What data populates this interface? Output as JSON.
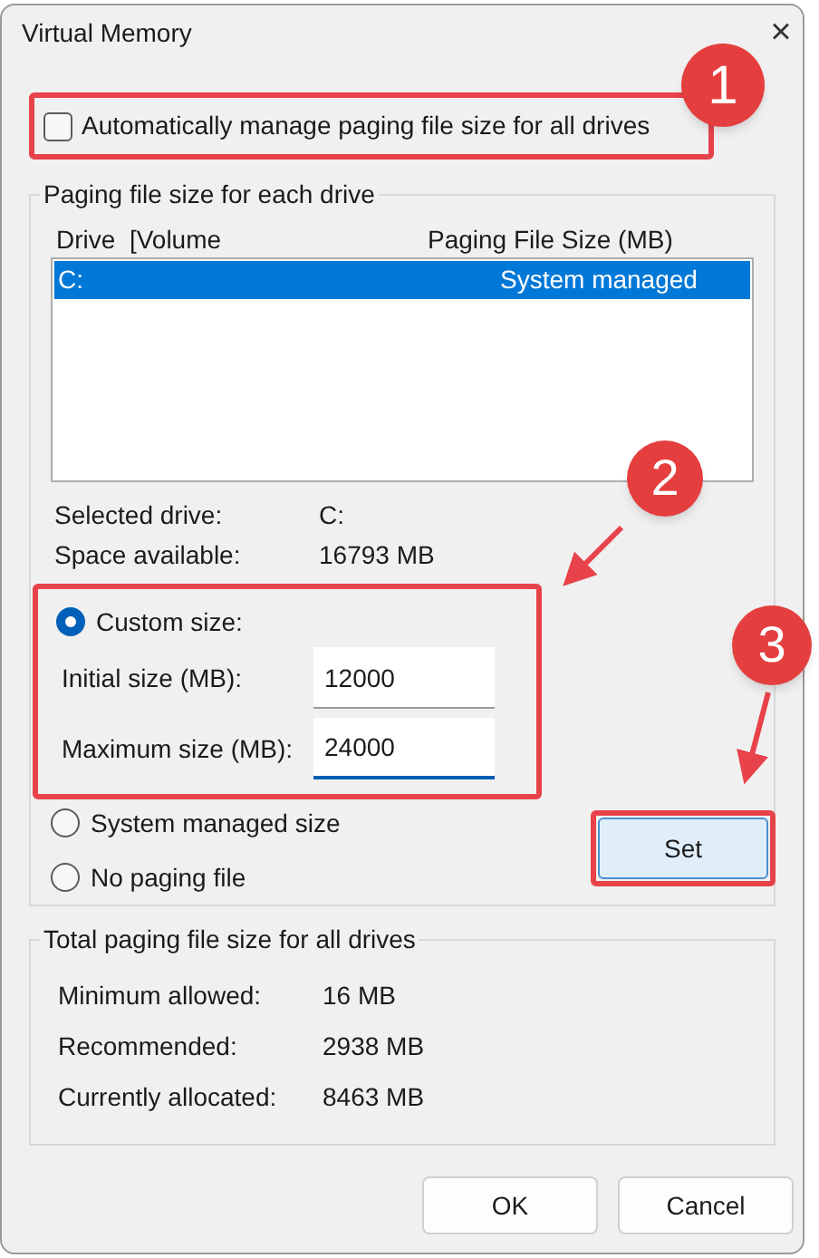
{
  "window": {
    "title": "Virtual Memory",
    "close": "×"
  },
  "auto_manage": {
    "label": "Automatically manage paging file size for all drives",
    "checked": false
  },
  "drives_group": {
    "title": "Paging file size for each drive",
    "columns": [
      "Drive  [Volume",
      "Paging File Size (MB)"
    ],
    "rows": [
      {
        "drive": "C:",
        "size": "System managed",
        "selected": true
      }
    ],
    "info": [
      {
        "label": "Selected drive:",
        "value": "C:"
      },
      {
        "label": "Space available:",
        "value": "16793 MB"
      }
    ],
    "options": [
      {
        "label": "Custom size:",
        "selected": true
      },
      {
        "label": "System managed size",
        "selected": false
      },
      {
        "label": "No paging file",
        "selected": false
      }
    ],
    "fields": [
      {
        "label": "Initial size (MB):",
        "value": "12000",
        "focused": false
      },
      {
        "label": "Maximum size (MB):",
        "value": "24000",
        "focused": true
      }
    ],
    "set_button": "Set"
  },
  "totals_group": {
    "title": "Total paging file size for all drives",
    "rows": [
      {
        "label": "Minimum allowed:",
        "value": "16 MB"
      },
      {
        "label": "Recommended:",
        "value": "2938 MB"
      },
      {
        "label": "Currently allocated:",
        "value": "8463 MB"
      }
    ]
  },
  "buttons": [
    "OK",
    "Cancel"
  ],
  "callouts": [
    {
      "label": "1"
    },
    {
      "label": "2"
    },
    {
      "label": "3"
    }
  ]
}
